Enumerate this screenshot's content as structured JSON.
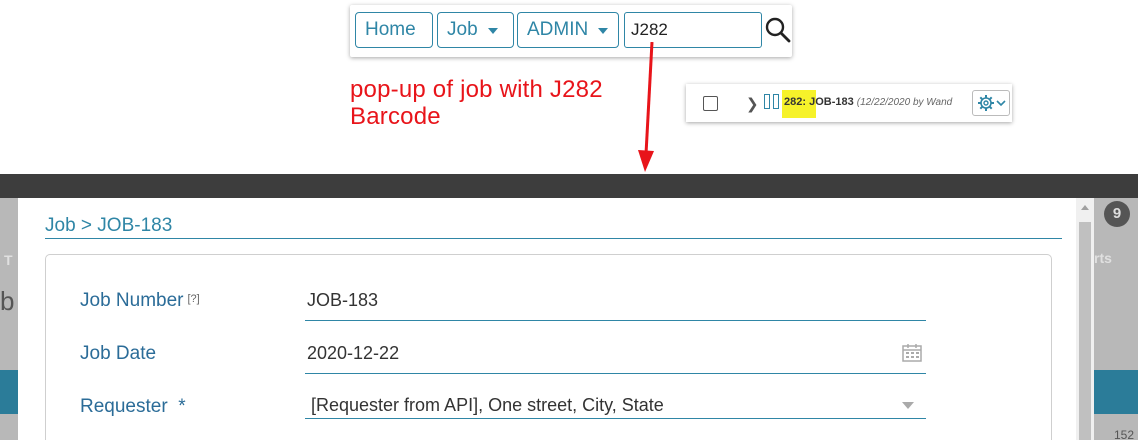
{
  "navbar": {
    "home_label": "Home",
    "job_label": "Job",
    "admin_label": "ADMIN",
    "search_value": "J282",
    "accent_color": "#2f86a6"
  },
  "annotation": {
    "line1": "pop-up of job with J282",
    "line2": "Barcode",
    "color": "#e8141a"
  },
  "result_row": {
    "highlight_text": "282:",
    "title": " JOB-183 ",
    "meta": "(12/22/2020 by Wand",
    "highlight_color": "#f6f22a"
  },
  "background": {
    "badge_count": "9",
    "frag_left": "T",
    "frag_right": "rts",
    "frag_b": "b",
    "frag_num": "152"
  },
  "modal": {
    "breadcrumb": "Job > JOB-183",
    "fields": [
      {
        "label": "Job Number",
        "help": "[?]",
        "value": "JOB-183"
      },
      {
        "label": "Job Date",
        "value": "2020-12-22"
      },
      {
        "label": "Requester  *",
        "value": "[Requester from API], One street, City, State"
      }
    ]
  }
}
